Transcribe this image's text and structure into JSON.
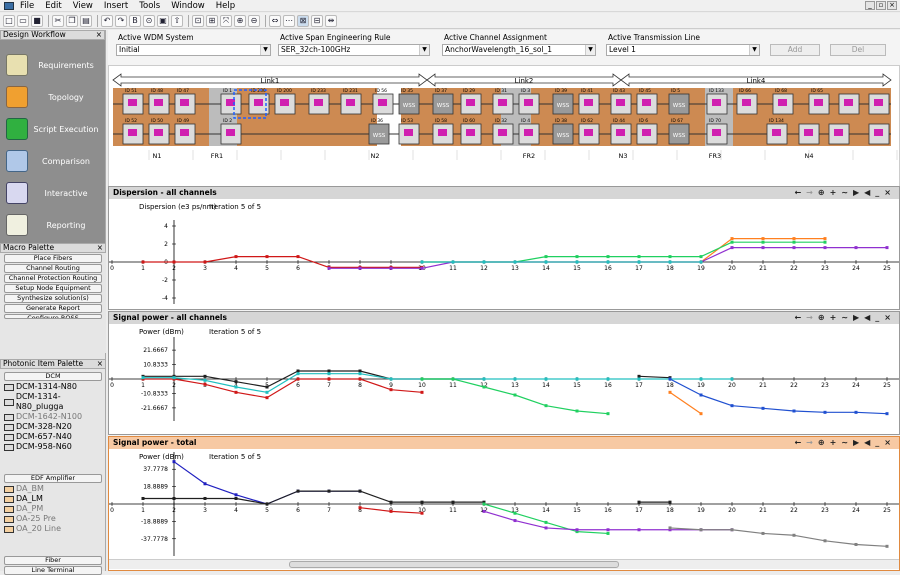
{
  "menu": [
    "File",
    "Edit",
    "View",
    "Insert",
    "Tools",
    "Window",
    "Help"
  ],
  "toolbar_icons": [
    "new-icon",
    "open-icon",
    "save-icon",
    "cut-icon",
    "copy-icon",
    "paste-icon",
    "undo-icon",
    "redo-icon",
    "bold-icon",
    "connect-icon",
    "node-icon",
    "pin-icon",
    "zoom-fit-icon",
    "zoom-in-icon",
    "zoom-out-icon",
    "ruler-icon",
    "grid-icon",
    "layout-icon",
    "split-icon",
    "link-icon"
  ],
  "workflow": {
    "title": "Design Workflow",
    "items": [
      {
        "label": "Requirements"
      },
      {
        "label": "Topology"
      },
      {
        "label": "Script Execution"
      },
      {
        "label": "Comparison"
      },
      {
        "label": "Interactive"
      },
      {
        "label": "Reporting"
      }
    ]
  },
  "macro": {
    "title": "Macro Palette",
    "items": [
      "Place Fibers",
      "Channel Routing",
      "Channel Protection Routing",
      "Setup Node Equipment",
      "Synthesize solution(s)",
      "Generate Report",
      "Configure ROSS"
    ]
  },
  "photonic": {
    "title": "Photonic Item Palette",
    "dcm_btn": "DCM",
    "dcm": [
      "DCM-1314-N80",
      "DCM-1314-N80_plugga",
      "DCM-1642-N100",
      "DCM-328-N20",
      "DCM-657-N40",
      "DCM-958-N60"
    ],
    "edfa_btn": "EDF Amplifier",
    "edfa": [
      "DA_BM",
      "DA_LM",
      "DA_PM",
      "OA-25 Pre",
      "OA_20 Line"
    ],
    "fiber_btn": "Fiber",
    "lt_btn": "Line Terminal"
  },
  "selectors": {
    "wdm_label": "Active WDM System",
    "wdm_value": "Initial",
    "span_label": "Active Span Engineering Rule",
    "span_value": "SER_32ch-100GHz",
    "chan_label": "Active Channel Assignment",
    "chan_value": "AnchorWavelength_16_sol_1",
    "tl_label": "Active Transmission Line",
    "tl_value": "Level 1",
    "add": "Add",
    "del": "Del"
  },
  "links": [
    "Link1",
    "Link2",
    "Link4"
  ],
  "nodes": [
    "N1",
    "FR1",
    "N2",
    "FR2",
    "N3",
    "FR3",
    "N4"
  ],
  "element_ids_top": [
    "ID 51",
    "ID 48",
    "ID 47",
    "ID 1",
    "ID 230",
    "ID 200",
    "ID 233",
    "ID 231",
    "ID 56",
    "ID 35",
    "ID 37",
    "ID 29",
    "ID 31",
    "ID 3",
    "ID 39",
    "ID 41",
    "ID 43",
    "ID 45",
    "ID 5",
    "ID 133",
    "ID 66",
    "ID 68",
    "ID 65"
  ],
  "element_ids_bottom": [
    "ID 52",
    "ID 50",
    "ID 49",
    "ID 2",
    "ID 36",
    "ID 53",
    "ID 58",
    "ID 60",
    "ID 32",
    "ID 4",
    "ID 38",
    "ID 62",
    "ID 44",
    "ID 6",
    "ID 67",
    "ID 70",
    "ID 134"
  ],
  "panels": {
    "disp": {
      "title": "Dispersion - all channels",
      "ylabel": "Dispersion (e3 ps/nm)",
      "iter": "Iteration 5 of 5",
      "yticks": [
        "4",
        "2",
        "0",
        "-2",
        "-4"
      ]
    },
    "sig": {
      "title": "Signal power - all channels",
      "ylabel": "Power (dBm)",
      "iter": "Iteration 5 of 5",
      "yticks": [
        "21.6667",
        "10.8333",
        "-10.8333",
        "-21.6667"
      ]
    },
    "tot": {
      "title": "Signal power - total",
      "ylabel": "Power (dBm)",
      "iter": "Iteration 5 of 5",
      "yticks": [
        "37.7778",
        "18.8889",
        "-18.8889",
        "-37.7778"
      ]
    }
  },
  "xticks": [
    "0",
    "1",
    "2",
    "3",
    "4",
    "5",
    "6",
    "7",
    "8",
    "9",
    "10",
    "11",
    "12",
    "13",
    "14",
    "15",
    "16",
    "17",
    "18",
    "19",
    "20",
    "21",
    "22",
    "23",
    "24",
    "25"
  ],
  "chart_data": [
    {
      "type": "line",
      "title": "Dispersion - all channels",
      "ylabel": "Dispersion (e3 ps/nm)",
      "ylim": [
        -4,
        4
      ],
      "x": [
        0,
        1,
        2,
        3,
        4,
        5,
        6,
        7,
        8,
        9,
        10,
        11,
        12,
        13,
        14,
        15,
        16,
        17,
        18,
        19,
        20,
        21,
        22,
        23,
        24,
        25
      ],
      "series": [
        {
          "color": "#d01818",
          "values": [
            null,
            0,
            0,
            0,
            0.6,
            0.6,
            0.6,
            -0.6,
            -0.6,
            -0.6,
            -0.6,
            null,
            null,
            null,
            null,
            null,
            null,
            null,
            null,
            null,
            null,
            null,
            null,
            null,
            null,
            null
          ]
        },
        {
          "color": "#ff8020",
          "values": [
            null,
            null,
            null,
            null,
            null,
            null,
            null,
            null,
            null,
            null,
            0,
            0,
            0,
            0,
            0,
            0,
            0,
            0,
            0,
            0,
            2.6,
            2.6,
            2.6,
            2.6,
            null,
            null
          ]
        },
        {
          "color": "#20d060",
          "values": [
            null,
            null,
            null,
            null,
            null,
            null,
            null,
            null,
            null,
            null,
            0,
            0,
            0,
            0,
            0.6,
            0.6,
            0.6,
            0.6,
            0.6,
            0.6,
            2.2,
            2.2,
            2.2,
            2.2,
            null,
            null
          ]
        },
        {
          "color": "#9030d0",
          "values": [
            null,
            null,
            null,
            null,
            null,
            null,
            null,
            -0.7,
            -0.7,
            -0.7,
            -0.7,
            0,
            0,
            0,
            0,
            0,
            0,
            0,
            0,
            0,
            1.6,
            1.6,
            1.6,
            1.6,
            1.6,
            1.6
          ]
        },
        {
          "color": "#20c0c0",
          "values": [
            null,
            null,
            null,
            null,
            null,
            null,
            null,
            null,
            null,
            null,
            0,
            0,
            0,
            0,
            0,
            0,
            0,
            0,
            0,
            0,
            null,
            null,
            null,
            null,
            null,
            null
          ]
        }
      ]
    },
    {
      "type": "line",
      "title": "Signal power - all channels",
      "ylabel": "Power (dBm)",
      "ylim": [
        -27,
        27
      ],
      "x": [
        0,
        1,
        2,
        3,
        4,
        5,
        6,
        7,
        8,
        9,
        10,
        11,
        12,
        13,
        14,
        15,
        16,
        17,
        18,
        19,
        20,
        21,
        22,
        23,
        24,
        25
      ],
      "series": [
        {
          "color": "#202020",
          "values": [
            null,
            2,
            2,
            2,
            -2,
            -6,
            6,
            6,
            6,
            0,
            0,
            0,
            0,
            null,
            null,
            null,
            null,
            2,
            1,
            null,
            null,
            null,
            null,
            null,
            null,
            null
          ]
        },
        {
          "color": "#d01818",
          "values": [
            null,
            0,
            0,
            -4,
            -10,
            -14,
            0,
            0,
            0,
            -8,
            -10,
            null,
            null,
            null,
            null,
            null,
            null,
            null,
            null,
            null,
            null,
            null,
            null,
            null,
            null,
            null
          ]
        },
        {
          "color": "#20c0c0",
          "values": [
            null,
            1,
            1,
            -1,
            -6,
            -10,
            4,
            4,
            4,
            0,
            0,
            0,
            0,
            0,
            0,
            0,
            0,
            0,
            0,
            0,
            0,
            null,
            null,
            null,
            null,
            null
          ]
        },
        {
          "color": "#20d060",
          "values": [
            null,
            null,
            null,
            null,
            null,
            null,
            null,
            null,
            null,
            null,
            0,
            0,
            -6,
            -12,
            -20,
            -24,
            -26,
            null,
            null,
            null,
            null,
            null,
            null,
            null,
            null,
            null
          ]
        },
        {
          "color": "#2050d0",
          "values": [
            null,
            null,
            null,
            null,
            null,
            null,
            null,
            null,
            null,
            null,
            null,
            null,
            null,
            null,
            null,
            null,
            null,
            null,
            0,
            -12,
            -20,
            -22,
            -24,
            -25,
            -25,
            -26
          ]
        },
        {
          "color": "#ff8020",
          "values": [
            null,
            null,
            null,
            null,
            null,
            null,
            null,
            null,
            null,
            null,
            null,
            null,
            null,
            null,
            null,
            null,
            null,
            null,
            -10,
            -26,
            null,
            null,
            null,
            null,
            null,
            null
          ]
        }
      ]
    },
    {
      "type": "line",
      "title": "Signal power - total",
      "ylabel": "Power (dBm)",
      "ylim": [
        -50,
        50
      ],
      "x": [
        0,
        1,
        2,
        3,
        4,
        5,
        6,
        7,
        8,
        9,
        10,
        11,
        12,
        13,
        14,
        15,
        16,
        17,
        18,
        19,
        20,
        21,
        22,
        23,
        24,
        25
      ],
      "series": [
        {
          "color": "#2020c0",
          "values": [
            null,
            null,
            46,
            22,
            10,
            0,
            14,
            14,
            14,
            null,
            null,
            null,
            null,
            null,
            null,
            null,
            null,
            null,
            null,
            null,
            null,
            null,
            null,
            null,
            null,
            null
          ]
        },
        {
          "color": "#202020",
          "values": [
            null,
            6,
            6,
            6,
            6,
            0,
            14,
            14,
            14,
            2,
            2,
            2,
            2,
            null,
            null,
            null,
            null,
            2,
            2,
            null,
            null,
            null,
            null,
            null,
            null,
            null
          ]
        },
        {
          "color": "#d01818",
          "values": [
            null,
            null,
            null,
            null,
            null,
            null,
            null,
            null,
            -4,
            -8,
            -10,
            null,
            null,
            null,
            null,
            null,
            null,
            null,
            null,
            null,
            null,
            null,
            null,
            null,
            null,
            null
          ]
        },
        {
          "color": "#20d060",
          "values": [
            null,
            null,
            null,
            null,
            null,
            null,
            null,
            null,
            null,
            null,
            null,
            null,
            0,
            -10,
            -20,
            -30,
            -32,
            null,
            null,
            null,
            null,
            null,
            null,
            null,
            null,
            null
          ]
        },
        {
          "color": "#9030d0",
          "values": [
            null,
            null,
            null,
            null,
            null,
            null,
            null,
            null,
            null,
            null,
            null,
            null,
            -8,
            -18,
            -26,
            -28,
            -28,
            -28,
            -28,
            -28,
            -28,
            null,
            null,
            null,
            null,
            null
          ]
        },
        {
          "color": "#808080",
          "values": [
            null,
            null,
            null,
            null,
            null,
            null,
            null,
            null,
            null,
            null,
            null,
            null,
            null,
            null,
            null,
            null,
            null,
            null,
            -26,
            -28,
            -28,
            -32,
            -34,
            -40,
            -44,
            -46
          ]
        }
      ]
    }
  ]
}
